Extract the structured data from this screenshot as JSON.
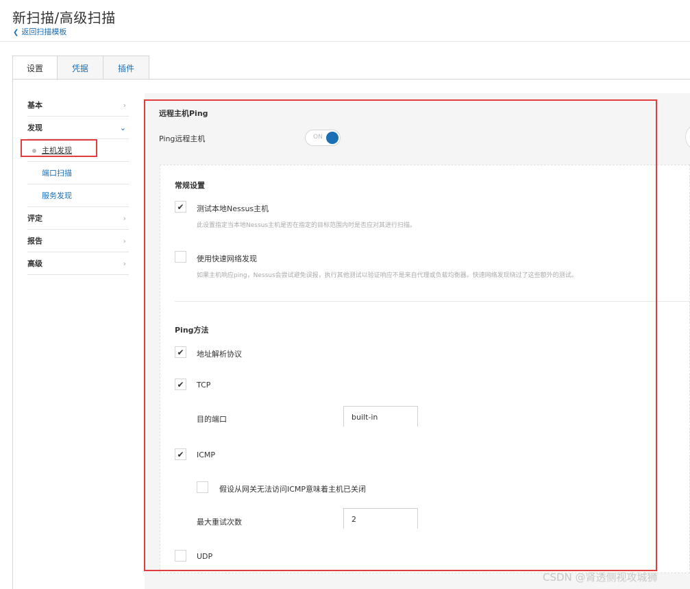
{
  "header": {
    "title": "新扫描/高级扫描",
    "back_label": "返回扫描模板"
  },
  "tabs": [
    "设置",
    "凭据",
    "插件"
  ],
  "sidebar": {
    "basic": "基本",
    "discovery": "发现",
    "host_discovery": "主机发现",
    "port_scan": "端口扫描",
    "service_discovery": "服务发现",
    "assessment": "评定",
    "report": "报告",
    "advanced": "高级"
  },
  "remote_ping": {
    "title": "远程主机Ping",
    "ping_label": "Ping远程主机",
    "toggle_text": "ON",
    "toggle_on": true
  },
  "general": {
    "title": "常规设置",
    "test_local_label": "测试本地Nessus主机",
    "test_local_checked": true,
    "test_local_desc": "此设置指定当本地Nessus主机是否在指定的目标范围内时是否应对其进行扫描。",
    "fast_label": "使用快速网络发现",
    "fast_checked": false,
    "fast_desc": "如果主机响应ping，Nessus会尝试避免误报，执行其他测试以验证响应不是来自代理或负载均衡器。快速网络发现绕过了这些额外的测试。"
  },
  "ping_methods": {
    "title": "Ping方法",
    "arp_label": "地址解析协议",
    "arp_checked": true,
    "tcp_label": "TCP",
    "tcp_checked": true,
    "dest_port_label": "目的端口",
    "dest_port_value": "built-in",
    "icmp_label": "ICMP",
    "icmp_checked": true,
    "icmp_unreachable_label": "假设从网关无法访问ICMP意味着主机已关闭",
    "icmp_unreachable_checked": false,
    "max_retries_label": "最大重试次数",
    "max_retries_value": "2",
    "udp_label": "UDP",
    "udp_checked": false
  },
  "watermark": "CSDN @肾透侧视攻城狮",
  "colors": {
    "accent": "#1a6fb5",
    "highlight": "#e23b3b"
  }
}
